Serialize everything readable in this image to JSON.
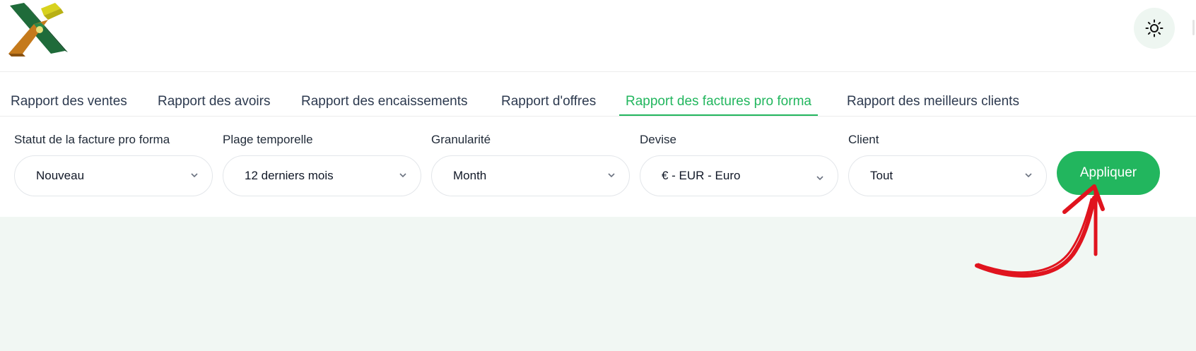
{
  "header": {
    "logo_icon": "brand-x-logo",
    "theme_toggle_icon": "sun-icon"
  },
  "tabs": [
    {
      "label": "Rapport des ventes",
      "active": false
    },
    {
      "label": "Rapport des avoirs",
      "active": false
    },
    {
      "label": "Rapport des encaissements",
      "active": false
    },
    {
      "label": "Rapport d'offres",
      "active": false
    },
    {
      "label": "Rapport des factures pro forma",
      "active": true
    },
    {
      "label": "Rapport des meilleurs clients",
      "active": false
    }
  ],
  "filters": {
    "status": {
      "label": "Statut de la facture pro forma",
      "value": "Nouveau"
    },
    "period": {
      "label": "Plage temporelle",
      "value": "12 derniers mois"
    },
    "granularity": {
      "label": "Granularité",
      "value": "Month"
    },
    "currency": {
      "label": "Devise",
      "value": "€ - EUR - Euro"
    },
    "client": {
      "label": "Client",
      "value": "Tout"
    },
    "apply_label": "Appliquer"
  },
  "annotation": {
    "icon": "red-hand-drawn-arrow-icon"
  },
  "colors": {
    "accent": "#22b65e",
    "tab_text": "#2d3a4f",
    "content_bg": "#f1f7f3",
    "annotation": "#e0141e"
  }
}
